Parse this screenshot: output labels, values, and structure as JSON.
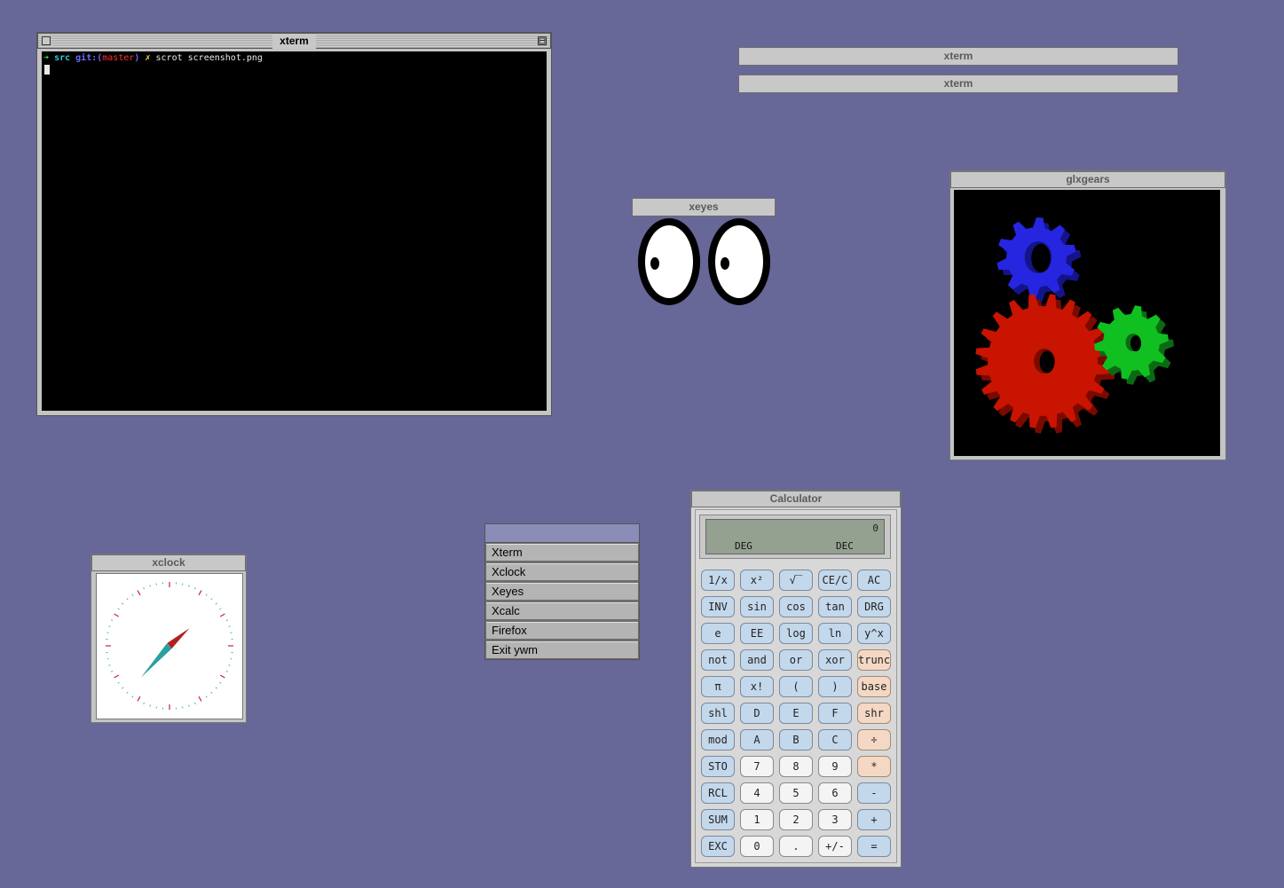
{
  "xterm_main": {
    "title": "xterm",
    "prompt_arrow": "➜",
    "prompt_dir": "src",
    "prompt_git": "git:(",
    "prompt_branch": "master",
    "prompt_git_close": ")",
    "prompt_dirty": "✗",
    "command": "scrot screenshot.png"
  },
  "minimized_windows": [
    {
      "title": "xterm"
    },
    {
      "title": "xterm"
    }
  ],
  "xeyes": {
    "title": "xeyes"
  },
  "glxgears": {
    "title": "glxgears",
    "gear_colors": {
      "large": "#c81400",
      "small_blue": "#2626e0",
      "small_green": "#10c020"
    }
  },
  "xclock": {
    "title": "xclock",
    "time": {
      "hour": 1,
      "minute": 37
    }
  },
  "root_menu": {
    "items": [
      "Xterm",
      "Xclock",
      "Xeyes",
      "Xcalc",
      "Firefox",
      "Exit ywm"
    ]
  },
  "calculator": {
    "title": "Calculator",
    "display_value": "0",
    "angle_mode": "DEG",
    "base_mode": "DEC",
    "keys": [
      [
        "1/x",
        "x²",
        "√‾",
        "CE/C",
        "AC"
      ],
      [
        "INV",
        "sin",
        "cos",
        "tan",
        "DRG"
      ],
      [
        "e",
        "EE",
        "log",
        "ln",
        "y^x"
      ],
      [
        "not",
        "and",
        "or",
        "xor",
        "trunc"
      ],
      [
        "π",
        "x!",
        "(",
        ")",
        "base"
      ],
      [
        "shl",
        "D",
        "E",
        "F",
        "shr"
      ],
      [
        "mod",
        "A",
        "B",
        "C",
        "÷"
      ],
      [
        "STO",
        "7",
        "8",
        "9",
        "*"
      ],
      [
        "RCL",
        "4",
        "5",
        "6",
        "-"
      ],
      [
        "SUM",
        "1",
        "2",
        "3",
        "+"
      ],
      [
        "EXC",
        "0",
        ".",
        "+/-",
        "="
      ]
    ]
  },
  "colors": {
    "desktop": "#676798",
    "titlebar": "#c8c8c8",
    "calc_key_blue": "#c4d8ec",
    "calc_key_white": "#f4f4f4",
    "calc_key_orange": "#f4d8c4"
  }
}
